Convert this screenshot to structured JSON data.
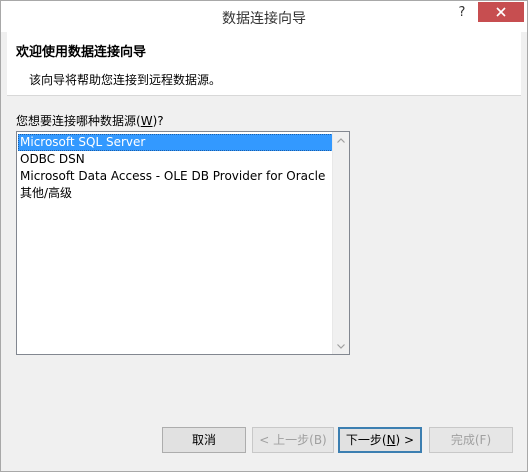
{
  "window": {
    "title": "数据连接向导",
    "help_label": "?"
  },
  "header": {
    "title": "欢迎使用数据连接向导",
    "subtitle": "该向导将帮助您连接到远程数据源。"
  },
  "datasource": {
    "label_prefix": "您想要连接哪种数据源(",
    "label_accel": "W",
    "label_suffix": ")?",
    "items": [
      "Microsoft SQL Server",
      "ODBC DSN",
      "Microsoft Data Access - OLE DB Provider for Oracle",
      "其他/高级"
    ],
    "selected": "Microsoft SQL Server"
  },
  "buttons": {
    "cancel": "取消",
    "back": "< 上一步(B)",
    "next_prefix": "下一步(",
    "next_accel": "N",
    "next_suffix": ") >",
    "finish": "完成(F)"
  }
}
